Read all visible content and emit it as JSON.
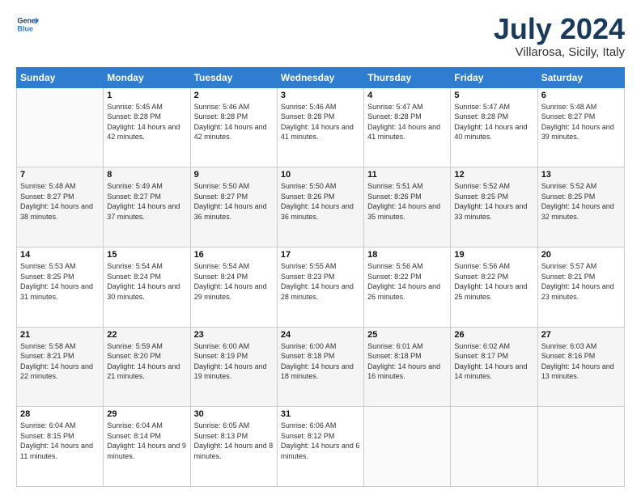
{
  "logo": {
    "line1": "General",
    "line2": "Blue"
  },
  "title": "July 2024",
  "location": "Villarosa, Sicily, Italy",
  "days_header": [
    "Sunday",
    "Monday",
    "Tuesday",
    "Wednesday",
    "Thursday",
    "Friday",
    "Saturday"
  ],
  "weeks": [
    [
      {
        "day": "",
        "sunrise": "",
        "sunset": "",
        "daylight": ""
      },
      {
        "day": "1",
        "sunrise": "Sunrise: 5:45 AM",
        "sunset": "Sunset: 8:28 PM",
        "daylight": "Daylight: 14 hours and 42 minutes."
      },
      {
        "day": "2",
        "sunrise": "Sunrise: 5:46 AM",
        "sunset": "Sunset: 8:28 PM",
        "daylight": "Daylight: 14 hours and 42 minutes."
      },
      {
        "day": "3",
        "sunrise": "Sunrise: 5:46 AM",
        "sunset": "Sunset: 8:28 PM",
        "daylight": "Daylight: 14 hours and 41 minutes."
      },
      {
        "day": "4",
        "sunrise": "Sunrise: 5:47 AM",
        "sunset": "Sunset: 8:28 PM",
        "daylight": "Daylight: 14 hours and 41 minutes."
      },
      {
        "day": "5",
        "sunrise": "Sunrise: 5:47 AM",
        "sunset": "Sunset: 8:28 PM",
        "daylight": "Daylight: 14 hours and 40 minutes."
      },
      {
        "day": "6",
        "sunrise": "Sunrise: 5:48 AM",
        "sunset": "Sunset: 8:27 PM",
        "daylight": "Daylight: 14 hours and 39 minutes."
      }
    ],
    [
      {
        "day": "7",
        "sunrise": "Sunrise: 5:48 AM",
        "sunset": "Sunset: 8:27 PM",
        "daylight": "Daylight: 14 hours and 38 minutes."
      },
      {
        "day": "8",
        "sunrise": "Sunrise: 5:49 AM",
        "sunset": "Sunset: 8:27 PM",
        "daylight": "Daylight: 14 hours and 37 minutes."
      },
      {
        "day": "9",
        "sunrise": "Sunrise: 5:50 AM",
        "sunset": "Sunset: 8:27 PM",
        "daylight": "Daylight: 14 hours and 36 minutes."
      },
      {
        "day": "10",
        "sunrise": "Sunrise: 5:50 AM",
        "sunset": "Sunset: 8:26 PM",
        "daylight": "Daylight: 14 hours and 36 minutes."
      },
      {
        "day": "11",
        "sunrise": "Sunrise: 5:51 AM",
        "sunset": "Sunset: 8:26 PM",
        "daylight": "Daylight: 14 hours and 35 minutes."
      },
      {
        "day": "12",
        "sunrise": "Sunrise: 5:52 AM",
        "sunset": "Sunset: 8:25 PM",
        "daylight": "Daylight: 14 hours and 33 minutes."
      },
      {
        "day": "13",
        "sunrise": "Sunrise: 5:52 AM",
        "sunset": "Sunset: 8:25 PM",
        "daylight": "Daylight: 14 hours and 32 minutes."
      }
    ],
    [
      {
        "day": "14",
        "sunrise": "Sunrise: 5:53 AM",
        "sunset": "Sunset: 8:25 PM",
        "daylight": "Daylight: 14 hours and 31 minutes."
      },
      {
        "day": "15",
        "sunrise": "Sunrise: 5:54 AM",
        "sunset": "Sunset: 8:24 PM",
        "daylight": "Daylight: 14 hours and 30 minutes."
      },
      {
        "day": "16",
        "sunrise": "Sunrise: 5:54 AM",
        "sunset": "Sunset: 8:24 PM",
        "daylight": "Daylight: 14 hours and 29 minutes."
      },
      {
        "day": "17",
        "sunrise": "Sunrise: 5:55 AM",
        "sunset": "Sunset: 8:23 PM",
        "daylight": "Daylight: 14 hours and 28 minutes."
      },
      {
        "day": "18",
        "sunrise": "Sunrise: 5:56 AM",
        "sunset": "Sunset: 8:22 PM",
        "daylight": "Daylight: 14 hours and 26 minutes."
      },
      {
        "day": "19",
        "sunrise": "Sunrise: 5:56 AM",
        "sunset": "Sunset: 8:22 PM",
        "daylight": "Daylight: 14 hours and 25 minutes."
      },
      {
        "day": "20",
        "sunrise": "Sunrise: 5:57 AM",
        "sunset": "Sunset: 8:21 PM",
        "daylight": "Daylight: 14 hours and 23 minutes."
      }
    ],
    [
      {
        "day": "21",
        "sunrise": "Sunrise: 5:58 AM",
        "sunset": "Sunset: 8:21 PM",
        "daylight": "Daylight: 14 hours and 22 minutes."
      },
      {
        "day": "22",
        "sunrise": "Sunrise: 5:59 AM",
        "sunset": "Sunset: 8:20 PM",
        "daylight": "Daylight: 14 hours and 21 minutes."
      },
      {
        "day": "23",
        "sunrise": "Sunrise: 6:00 AM",
        "sunset": "Sunset: 8:19 PM",
        "daylight": "Daylight: 14 hours and 19 minutes."
      },
      {
        "day": "24",
        "sunrise": "Sunrise: 6:00 AM",
        "sunset": "Sunset: 8:18 PM",
        "daylight": "Daylight: 14 hours and 18 minutes."
      },
      {
        "day": "25",
        "sunrise": "Sunrise: 6:01 AM",
        "sunset": "Sunset: 8:18 PM",
        "daylight": "Daylight: 14 hours and 16 minutes."
      },
      {
        "day": "26",
        "sunrise": "Sunrise: 6:02 AM",
        "sunset": "Sunset: 8:17 PM",
        "daylight": "Daylight: 14 hours and 14 minutes."
      },
      {
        "day": "27",
        "sunrise": "Sunrise: 6:03 AM",
        "sunset": "Sunset: 8:16 PM",
        "daylight": "Daylight: 14 hours and 13 minutes."
      }
    ],
    [
      {
        "day": "28",
        "sunrise": "Sunrise: 6:04 AM",
        "sunset": "Sunset: 8:15 PM",
        "daylight": "Daylight: 14 hours and 11 minutes."
      },
      {
        "day": "29",
        "sunrise": "Sunrise: 6:04 AM",
        "sunset": "Sunset: 8:14 PM",
        "daylight": "Daylight: 14 hours and 9 minutes."
      },
      {
        "day": "30",
        "sunrise": "Sunrise: 6:05 AM",
        "sunset": "Sunset: 8:13 PM",
        "daylight": "Daylight: 14 hours and 8 minutes."
      },
      {
        "day": "31",
        "sunrise": "Sunrise: 6:06 AM",
        "sunset": "Sunset: 8:12 PM",
        "daylight": "Daylight: 14 hours and 6 minutes."
      },
      {
        "day": "",
        "sunrise": "",
        "sunset": "",
        "daylight": ""
      },
      {
        "day": "",
        "sunrise": "",
        "sunset": "",
        "daylight": ""
      },
      {
        "day": "",
        "sunrise": "",
        "sunset": "",
        "daylight": ""
      }
    ]
  ]
}
